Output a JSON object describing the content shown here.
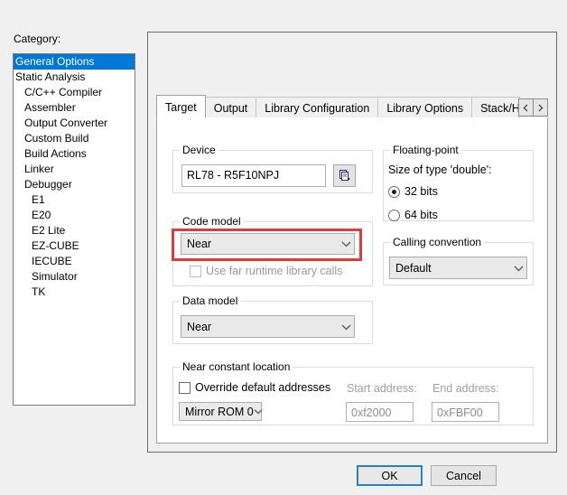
{
  "dialog": {
    "category_label": "Category:",
    "categories": [
      {
        "label": "General Options",
        "indent": 0,
        "selected": true
      },
      {
        "label": "Static Analysis",
        "indent": 0,
        "selected": false
      },
      {
        "label": "C/C++ Compiler",
        "indent": 1,
        "selected": false
      },
      {
        "label": "Assembler",
        "indent": 1,
        "selected": false
      },
      {
        "label": "Output Converter",
        "indent": 1,
        "selected": false
      },
      {
        "label": "Custom Build",
        "indent": 1,
        "selected": false
      },
      {
        "label": "Build Actions",
        "indent": 1,
        "selected": false
      },
      {
        "label": "Linker",
        "indent": 1,
        "selected": false
      },
      {
        "label": "Debugger",
        "indent": 1,
        "selected": false
      },
      {
        "label": "E1",
        "indent": 2,
        "selected": false
      },
      {
        "label": "E20",
        "indent": 2,
        "selected": false
      },
      {
        "label": "E2 Lite",
        "indent": 2,
        "selected": false
      },
      {
        "label": "EZ-CUBE",
        "indent": 2,
        "selected": false
      },
      {
        "label": "IECUBE",
        "indent": 2,
        "selected": false
      },
      {
        "label": "Simulator",
        "indent": 2,
        "selected": false
      },
      {
        "label": "TK",
        "indent": 2,
        "selected": false
      }
    ],
    "tabs": [
      {
        "label": "Target",
        "active": true
      },
      {
        "label": "Output",
        "active": false
      },
      {
        "label": "Library Configuration",
        "active": false
      },
      {
        "label": "Library Options",
        "active": false
      },
      {
        "label": "Stack/Heap",
        "active": false,
        "clipped": true
      }
    ],
    "tab_scroll_prev": "scroll-left-arrow",
    "tab_scroll_next": "scroll-right-arrow",
    "device": {
      "legend": "Device",
      "value": "RL78 - R5F10NPJ",
      "browse_icon": "device-select-icon"
    },
    "code_model": {
      "legend": "Code model",
      "value": "Near",
      "far_runtime_label": "Use far runtime library calls",
      "far_runtime_checked": false,
      "far_runtime_disabled": true,
      "highlight_color": "#e03a3a"
    },
    "data_model": {
      "legend": "Data model",
      "value": "Near"
    },
    "near_constant_location": {
      "legend": "Near constant location",
      "override_label": "Override default addresses",
      "override_checked": false,
      "mirror_value": "Mirror ROM 0",
      "start_label": "Start address:",
      "start_value": "0xf2000",
      "end_label": "End address:",
      "end_value": "0xFBF00"
    },
    "floating_point": {
      "legend": "Floating-point",
      "size_label": "Size of type 'double':",
      "options": [
        {
          "label": "32 bits",
          "selected": true
        },
        {
          "label": "64 bits",
          "selected": false
        }
      ]
    },
    "calling_convention": {
      "legend": "Calling convention",
      "value": "Default"
    },
    "buttons": {
      "ok": "OK",
      "cancel": "Cancel"
    }
  }
}
